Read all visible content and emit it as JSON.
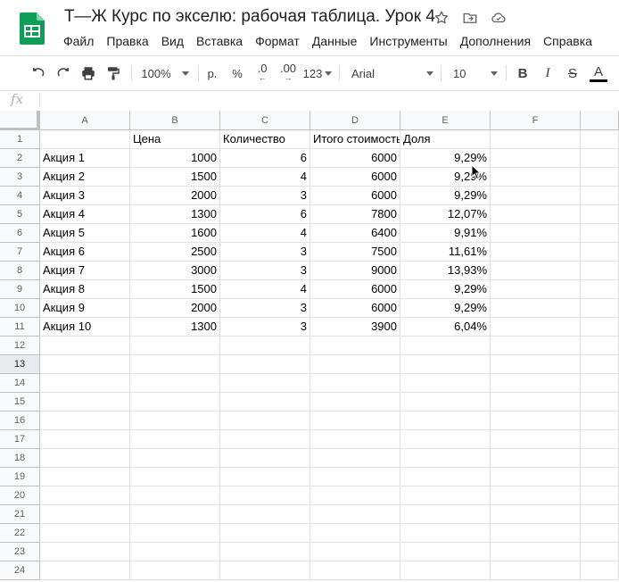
{
  "doc": {
    "title": "Т—Ж Курс по экселю: рабочая таблица. Урок 4"
  },
  "title_icons": [
    "star-icon",
    "move-to-folder-icon",
    "cloud-status-icon"
  ],
  "menu": [
    "Файл",
    "Правка",
    "Вид",
    "Вставка",
    "Формат",
    "Данные",
    "Инструменты",
    "Дополнения",
    "Справка"
  ],
  "toolbar": {
    "zoom": "100%",
    "currency": "р.",
    "percent": "%",
    "dec_decrease": ".0",
    "dec_increase": ".00",
    "more_formats": "123",
    "font": "Arial",
    "font_size": "10",
    "bold": "B",
    "italic": "I",
    "strike": "S",
    "text_color": "A"
  },
  "formula_bar": {
    "fx": "fx",
    "value": ""
  },
  "columns": [
    "A",
    "B",
    "C",
    "D",
    "E",
    "F"
  ],
  "rows": [
    [
      "",
      "Цена",
      "Количество",
      "Итого стоимость",
      "Доля",
      ""
    ],
    [
      "Акция 1",
      "1000",
      "6",
      "6000",
      "9,29%",
      ""
    ],
    [
      "Акция 2",
      "1500",
      "4",
      "6000",
      "9,29%",
      ""
    ],
    [
      "Акция 3",
      "2000",
      "3",
      "6000",
      "9,29%",
      ""
    ],
    [
      "Акция 4",
      "1300",
      "6",
      "7800",
      "12,07%",
      ""
    ],
    [
      "Акция 5",
      "1600",
      "4",
      "6400",
      "9,91%",
      ""
    ],
    [
      "Акция 6",
      "2500",
      "3",
      "7500",
      "11,61%",
      ""
    ],
    [
      "Акция 7",
      "3000",
      "3",
      "9000",
      "13,93%",
      ""
    ],
    [
      "Акция 8",
      "1500",
      "4",
      "6000",
      "9,29%",
      ""
    ],
    [
      "Акция 9",
      "2000",
      "3",
      "6000",
      "9,29%",
      ""
    ],
    [
      "Акция 10",
      "1300",
      "3",
      "3900",
      "6,04%",
      ""
    ]
  ],
  "row_numbers": [
    "1",
    "2",
    "3",
    "4",
    "5",
    "6",
    "7",
    "8",
    "9",
    "10",
    "11",
    "12",
    "13",
    "14",
    "15",
    "16",
    "17",
    "18",
    "19",
    "20",
    "21",
    "22",
    "23",
    "24"
  ],
  "selected_row": "13",
  "colors": {
    "logo_green": "#0f9d58",
    "header_bg": "#f8f9fa",
    "selected_row_bg": "#e8eaed"
  }
}
